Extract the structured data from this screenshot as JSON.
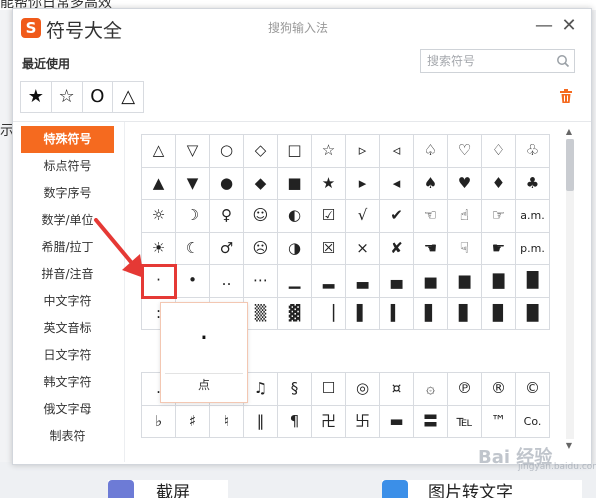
{
  "background": {
    "top_text": "能帮你日常多高效",
    "left_text": "示",
    "cards": [
      {
        "label": "截屏",
        "icon": "screenshot-app-icon",
        "color": "#6d7bd6"
      },
      {
        "label": "图片转文字",
        "icon": "image-to-text-app-icon",
        "color": "#3b8fe8"
      }
    ]
  },
  "dialog": {
    "logo_text": "S",
    "title": "符号大全",
    "app_name": "搜狗输入法",
    "minimize_label": "—",
    "close_label": "✕"
  },
  "recent": {
    "label": "最近使用",
    "symbols": [
      "★",
      "☆",
      "O",
      "△"
    ]
  },
  "search": {
    "placeholder": "搜索符号",
    "icon": "search-icon"
  },
  "categories": [
    {
      "label": "特殊符号",
      "active": true
    },
    {
      "label": "标点符号",
      "active": false
    },
    {
      "label": "数字序号",
      "active": false
    },
    {
      "label": "数学/单位",
      "active": false
    },
    {
      "label": "希腊/拉丁",
      "active": false
    },
    {
      "label": "拼音/注音",
      "active": false
    },
    {
      "label": "中文字符",
      "active": false
    },
    {
      "label": "英文音标",
      "active": false
    },
    {
      "label": "日文字符",
      "active": false
    },
    {
      "label": "韩文字符",
      "active": false
    },
    {
      "label": "俄文字母",
      "active": false
    },
    {
      "label": "制表符",
      "active": false
    }
  ],
  "grid_top": [
    [
      "△",
      "▽",
      "○",
      "◇",
      "□",
      "☆",
      "▹",
      "◃",
      "♤",
      "♡",
      "♢",
      "♧"
    ],
    [
      "▲",
      "▼",
      "●",
      "◆",
      "■",
      "★",
      "▸",
      "◂",
      "♠",
      "♥",
      "♦",
      "♣"
    ],
    [
      "☼",
      "☽",
      "♀",
      "☺",
      "◐",
      "☑",
      "√",
      "✔",
      "☜",
      "☝",
      "☞",
      "a.m."
    ],
    [
      "☀",
      "☾",
      "♂",
      "☹",
      "◑",
      "☒",
      "×",
      "✘",
      "☚",
      "☟",
      "☛",
      "p.m."
    ],
    [
      "·",
      "•",
      "‥",
      "⋯",
      "▁",
      "▂",
      "▃",
      "▄",
      "▅",
      "▆",
      "▇",
      "█"
    ],
    [
      ":",
      "",
      "",
      "▒",
      "▓",
      "▕",
      "▌",
      "▍",
      "▋",
      "▊",
      "▉",
      "█"
    ]
  ],
  "grid_bottom": [
    [
      ".",
      "",
      "",
      "♫",
      "§",
      "☐",
      "◎",
      "¤",
      "۞",
      "℗",
      "®",
      "©"
    ],
    [
      "♭",
      "♯",
      "♮",
      "‖",
      "¶",
      "卍",
      "卐",
      "▬",
      "〓",
      "℡",
      "™",
      "Co."
    ]
  ],
  "selected_symbol": "·",
  "preview": {
    "char": "·",
    "name": "点"
  },
  "watermark": {
    "text": "Bai 经验",
    "sub": "jingyan.baidu.com"
  },
  "colors": {
    "accent": "#f56a1f",
    "highlight": "#e53935",
    "logo": "#f05a1a"
  }
}
